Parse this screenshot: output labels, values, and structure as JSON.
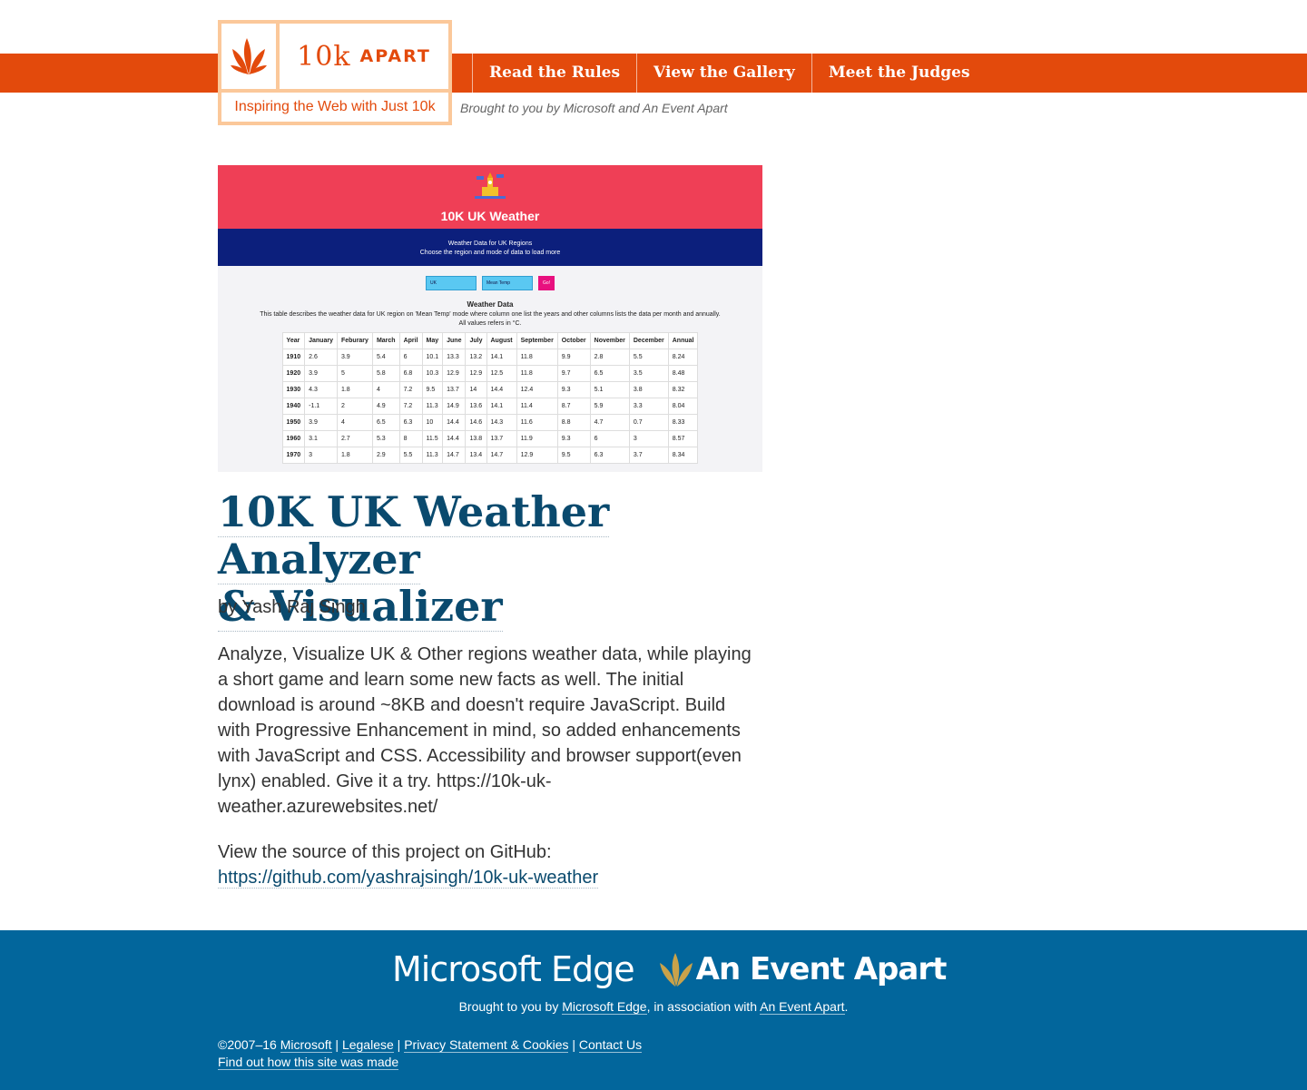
{
  "header": {
    "logo_big": "10k",
    "logo_small": "APART",
    "tagline": "Inspiring the Web with Just 10k",
    "brought": "Brought to you by Microsoft and An Event Apart",
    "nav": [
      "Read the Rules",
      "View the Gallery",
      "Meet the Judges"
    ]
  },
  "screenshot": {
    "app_title": "10K UK Weather",
    "subtitle1": "Weather Data for UK Regions",
    "subtitle2": "Choose the region and mode of data to load more",
    "region_select": "UK",
    "mode_select": "Mean Temp",
    "go_button": "Go!",
    "table_title": "Weather Data",
    "table_desc": "This table describes the weather data for UK region on 'Mean Temp' mode where column one list the years and other columns lists the data per month and annually.",
    "table_note": "All values refers in °C.",
    "columns": [
      "Year",
      "January",
      "Feburary",
      "March",
      "April",
      "May",
      "June",
      "July",
      "August",
      "September",
      "October",
      "November",
      "December",
      "Annual"
    ],
    "rows": [
      [
        "1910",
        "2.6",
        "3.9",
        "5.4",
        "6",
        "10.1",
        "13.3",
        "13.2",
        "14.1",
        "11.8",
        "9.9",
        "2.8",
        "5.5",
        "8.24"
      ],
      [
        "1920",
        "3.9",
        "5",
        "5.8",
        "6.8",
        "10.3",
        "12.9",
        "12.9",
        "12.5",
        "11.8",
        "9.7",
        "6.5",
        "3.5",
        "8.48"
      ],
      [
        "1930",
        "4.3",
        "1.8",
        "4",
        "7.2",
        "9.5",
        "13.7",
        "14",
        "14.4",
        "12.4",
        "9.3",
        "5.1",
        "3.8",
        "8.32"
      ],
      [
        "1940",
        "-1.1",
        "2",
        "4.9",
        "7.2",
        "11.3",
        "14.9",
        "13.6",
        "14.1",
        "11.4",
        "8.7",
        "5.9",
        "3.3",
        "8.04"
      ],
      [
        "1950",
        "3.9",
        "4",
        "6.5",
        "6.3",
        "10",
        "14.4",
        "14.6",
        "14.3",
        "11.6",
        "8.8",
        "4.7",
        "0.7",
        "8.33"
      ],
      [
        "1960",
        "3.1",
        "2.7",
        "5.3",
        "8",
        "11.5",
        "14.4",
        "13.8",
        "13.7",
        "11.9",
        "9.3",
        "6",
        "3",
        "8.57"
      ],
      [
        "1970",
        "3",
        "1.8",
        "2.9",
        "5.5",
        "11.3",
        "14.7",
        "13.4",
        "14.7",
        "12.9",
        "9.5",
        "6.3",
        "3.7",
        "8.34"
      ]
    ]
  },
  "entry": {
    "title_line1": "10K UK Weather Analyzer",
    "title_line2": "& Visualizer",
    "author": "by Yash Raj Singh",
    "description": "Analyze, Visualize UK & Other regions weather data, while playing a short game and learn some new facts as well. The initial download is around ~8KB and doesn't require JavaScript. Build with Progressive Enhancement in mind, so added enhancements with JavaScript and CSS. Accessibility and browser support(even lynx) enabled. Give it a try. https://10k-uk-weather.azurewebsites.net/",
    "source_label": "View the source of this project on GitHub:",
    "source_url": "https://github.com/yashrajsingh/10k-uk-weather"
  },
  "footer": {
    "ms_logo": "Microsoft Edge",
    "aea_logo": "An Event Apart",
    "brought_prefix": "Brought to you by",
    "brought_ms": "Microsoft Edge",
    "brought_mid": ", in association with",
    "brought_aea": "An Event Apart",
    "brought_end": ".",
    "copyright": "©2007–16",
    "microsoft": "Microsoft",
    "legalese": "Legalese",
    "privacy": "Privacy Statement & Cookies",
    "contact": "Contact Us",
    "howmade": "Find out how this site was made"
  },
  "colors": {
    "accent": "#e34a0c",
    "logo_border": "#fbc89a",
    "title_blue": "#0a4a6e",
    "footer_blue": "#02669c"
  }
}
